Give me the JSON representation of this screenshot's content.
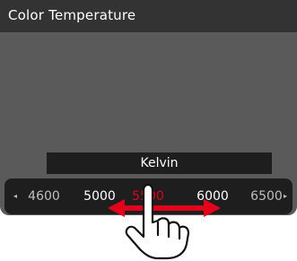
{
  "title": "Color Temperature",
  "unit_label": "Kelvin",
  "scale": {
    "values": [
      "4600",
      "5000",
      "5500",
      "6000",
      "6500"
    ],
    "selected_index": 2,
    "left_arrow": "◂",
    "right_arrow": "▸"
  },
  "colors": {
    "screen_bg": "#5a5a5a",
    "title_bar": "#333333",
    "label_bg": "#1e1e1e",
    "selected_value": "#e3001b",
    "value_text": "#ffffff",
    "dim_value_text": "#bfbfbf",
    "gesture_arrow": "#e3001b"
  },
  "gesture": {
    "icon": "swipe-hand-icon",
    "direction": "left-right"
  }
}
